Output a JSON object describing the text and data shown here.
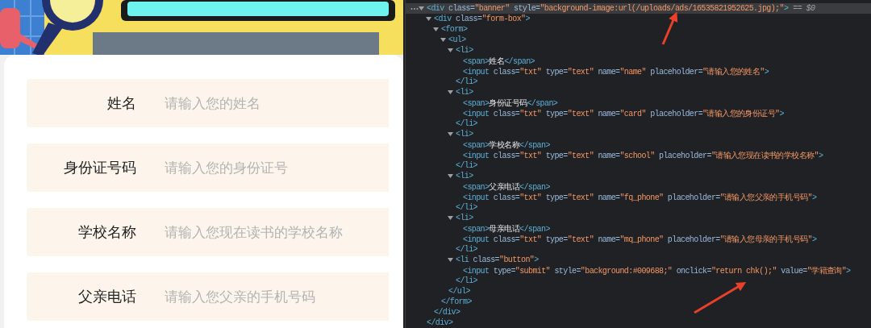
{
  "page": {
    "form": {
      "fields": [
        {
          "label": "姓名",
          "placeholder": "请输入您的姓名"
        },
        {
          "label": "身份证号码",
          "placeholder": "请输入您的身份证号"
        },
        {
          "label": "学校名称",
          "placeholder": "请输入您现在读书的学校名称"
        },
        {
          "label": "父亲电话",
          "placeholder": "请输入您父亲的手机号码"
        }
      ]
    }
  },
  "devtools": {
    "elements_tree": [
      {
        "expanded": true,
        "selected": true,
        "open": [
          {
            "kind": "tag",
            "text": "<div"
          },
          {
            "kind": "attr",
            "text": " class="
          },
          {
            "kind": "value",
            "text": "\"banner\""
          },
          {
            "kind": "attr",
            "text": " style="
          },
          {
            "kind": "value",
            "text": "\"background-image:url(/uploads/ads/16535821952625.jpg);\""
          },
          {
            "kind": "tag",
            "text": ">"
          }
        ],
        "marker": "== $0",
        "close": [
          {
            "kind": "tag",
            "text": "</div>"
          }
        ],
        "children": [
          {
            "expanded": true,
            "selected": false,
            "open": [
              {
                "kind": "tag",
                "text": "<div"
              },
              {
                "kind": "attr",
                "text": " class="
              },
              {
                "kind": "value",
                "text": "\"form-box\""
              },
              {
                "kind": "tag",
                "text": ">"
              }
            ],
            "close": [
              {
                "kind": "tag",
                "text": "</div>"
              }
            ],
            "children": [
              {
                "expanded": true,
                "selected": false,
                "open": [
                  {
                    "kind": "tag",
                    "text": "<form>"
                  }
                ],
                "close": [
                  {
                    "kind": "tag",
                    "text": "</form>"
                  }
                ],
                "children": [
                  {
                    "expanded": true,
                    "selected": false,
                    "open": [
                      {
                        "kind": "tag",
                        "text": "<ul>"
                      }
                    ],
                    "close": [
                      {
                        "kind": "tag",
                        "text": "</ul>"
                      }
                    ],
                    "children": [
                      {
                        "expanded": true,
                        "selected": false,
                        "open": [
                          {
                            "kind": "tag",
                            "text": "<li>"
                          }
                        ],
                        "close": [
                          {
                            "kind": "tag",
                            "text": "</li>"
                          }
                        ],
                        "children": [
                          {
                            "line": [
                              {
                                "kind": "tag",
                                "text": "<span>"
                              },
                              {
                                "kind": "text",
                                "text": "姓名"
                              },
                              {
                                "kind": "tag",
                                "text": "</span>"
                              }
                            ]
                          },
                          {
                            "line": [
                              {
                                "kind": "tag",
                                "text": "<input"
                              },
                              {
                                "kind": "attr",
                                "text": " class="
                              },
                              {
                                "kind": "value",
                                "text": "\"txt\""
                              },
                              {
                                "kind": "attr",
                                "text": " type="
                              },
                              {
                                "kind": "value",
                                "text": "\"text\""
                              },
                              {
                                "kind": "attr",
                                "text": " name="
                              },
                              {
                                "kind": "value",
                                "text": "\"name\""
                              },
                              {
                                "kind": "attr",
                                "text": " placeholder="
                              },
                              {
                                "kind": "value",
                                "text": "\"请输入您的姓名\""
                              },
                              {
                                "kind": "tag",
                                "text": ">"
                              }
                            ]
                          }
                        ]
                      },
                      {
                        "expanded": true,
                        "selected": false,
                        "open": [
                          {
                            "kind": "tag",
                            "text": "<li>"
                          }
                        ],
                        "close": [
                          {
                            "kind": "tag",
                            "text": "</li>"
                          }
                        ],
                        "children": [
                          {
                            "line": [
                              {
                                "kind": "tag",
                                "text": "<span>"
                              },
                              {
                                "kind": "text",
                                "text": "身份证号码"
                              },
                              {
                                "kind": "tag",
                                "text": "</span>"
                              }
                            ]
                          },
                          {
                            "line": [
                              {
                                "kind": "tag",
                                "text": "<input"
                              },
                              {
                                "kind": "attr",
                                "text": " class="
                              },
                              {
                                "kind": "value",
                                "text": "\"txt\""
                              },
                              {
                                "kind": "attr",
                                "text": " type="
                              },
                              {
                                "kind": "value",
                                "text": "\"text\""
                              },
                              {
                                "kind": "attr",
                                "text": " name="
                              },
                              {
                                "kind": "value",
                                "text": "\"card\""
                              },
                              {
                                "kind": "attr",
                                "text": " placeholder="
                              },
                              {
                                "kind": "value",
                                "text": "\"请输入您的身份证号\""
                              },
                              {
                                "kind": "tag",
                                "text": ">"
                              }
                            ]
                          }
                        ]
                      },
                      {
                        "expanded": true,
                        "selected": false,
                        "open": [
                          {
                            "kind": "tag",
                            "text": "<li>"
                          }
                        ],
                        "close": [
                          {
                            "kind": "tag",
                            "text": "</li>"
                          }
                        ],
                        "children": [
                          {
                            "line": [
                              {
                                "kind": "tag",
                                "text": "<span>"
                              },
                              {
                                "kind": "text",
                                "text": "学校名称"
                              },
                              {
                                "kind": "tag",
                                "text": "</span>"
                              }
                            ]
                          },
                          {
                            "line": [
                              {
                                "kind": "tag",
                                "text": "<input"
                              },
                              {
                                "kind": "attr",
                                "text": " class="
                              },
                              {
                                "kind": "value",
                                "text": "\"txt\""
                              },
                              {
                                "kind": "attr",
                                "text": " type="
                              },
                              {
                                "kind": "value",
                                "text": "\"text\""
                              },
                              {
                                "kind": "attr",
                                "text": " name="
                              },
                              {
                                "kind": "value",
                                "text": "\"school\""
                              },
                              {
                                "kind": "attr",
                                "text": " placeholder="
                              },
                              {
                                "kind": "value",
                                "text": "\"请输入您现在读书的学校名称\""
                              },
                              {
                                "kind": "tag",
                                "text": ">"
                              }
                            ]
                          }
                        ]
                      },
                      {
                        "expanded": true,
                        "selected": false,
                        "open": [
                          {
                            "kind": "tag",
                            "text": "<li>"
                          }
                        ],
                        "close": [
                          {
                            "kind": "tag",
                            "text": "</li>"
                          }
                        ],
                        "children": [
                          {
                            "line": [
                              {
                                "kind": "tag",
                                "text": "<span>"
                              },
                              {
                                "kind": "text",
                                "text": "父亲电话"
                              },
                              {
                                "kind": "tag",
                                "text": "</span>"
                              }
                            ]
                          },
                          {
                            "line": [
                              {
                                "kind": "tag",
                                "text": "<input"
                              },
                              {
                                "kind": "attr",
                                "text": " class="
                              },
                              {
                                "kind": "value",
                                "text": "\"txt\""
                              },
                              {
                                "kind": "attr",
                                "text": " type="
                              },
                              {
                                "kind": "value",
                                "text": "\"text\""
                              },
                              {
                                "kind": "attr",
                                "text": " name="
                              },
                              {
                                "kind": "value",
                                "text": "\"fq_phone\""
                              },
                              {
                                "kind": "attr",
                                "text": " placeholder="
                              },
                              {
                                "kind": "value",
                                "text": "\"请输入您父亲的手机号码\""
                              },
                              {
                                "kind": "tag",
                                "text": ">"
                              }
                            ]
                          }
                        ]
                      },
                      {
                        "expanded": true,
                        "selected": false,
                        "open": [
                          {
                            "kind": "tag",
                            "text": "<li>"
                          }
                        ],
                        "close": [
                          {
                            "kind": "tag",
                            "text": "</li>"
                          }
                        ],
                        "children": [
                          {
                            "line": [
                              {
                                "kind": "tag",
                                "text": "<span>"
                              },
                              {
                                "kind": "text",
                                "text": "母亲电话"
                              },
                              {
                                "kind": "tag",
                                "text": "</span>"
                              }
                            ]
                          },
                          {
                            "line": [
                              {
                                "kind": "tag",
                                "text": "<input"
                              },
                              {
                                "kind": "attr",
                                "text": " class="
                              },
                              {
                                "kind": "value",
                                "text": "\"txt\""
                              },
                              {
                                "kind": "attr",
                                "text": " type="
                              },
                              {
                                "kind": "value",
                                "text": "\"text\""
                              },
                              {
                                "kind": "attr",
                                "text": " name="
                              },
                              {
                                "kind": "value",
                                "text": "\"mq_phone\""
                              },
                              {
                                "kind": "attr",
                                "text": " placeholder="
                              },
                              {
                                "kind": "value",
                                "text": "\"请输入您母亲的手机号码\""
                              },
                              {
                                "kind": "tag",
                                "text": ">"
                              }
                            ]
                          }
                        ]
                      },
                      {
                        "expanded": true,
                        "selected": false,
                        "open": [
                          {
                            "kind": "tag",
                            "text": "<li"
                          },
                          {
                            "kind": "attr",
                            "text": " class="
                          },
                          {
                            "kind": "value",
                            "text": "\"button\""
                          },
                          {
                            "kind": "tag",
                            "text": ">"
                          }
                        ],
                        "close": [
                          {
                            "kind": "tag",
                            "text": "</li>"
                          }
                        ],
                        "children": [
                          {
                            "line": [
                              {
                                "kind": "tag",
                                "text": "<input"
                              },
                              {
                                "kind": "attr",
                                "text": " type="
                              },
                              {
                                "kind": "value",
                                "text": "\"submit\""
                              },
                              {
                                "kind": "attr",
                                "text": " style="
                              },
                              {
                                "kind": "value",
                                "text": "\"background:#009688;\""
                              },
                              {
                                "kind": "attr",
                                "text": " onclick="
                              },
                              {
                                "kind": "value",
                                "text": "\"return chk();\""
                              },
                              {
                                "kind": "attr",
                                "text": " value="
                              },
                              {
                                "kind": "value",
                                "text": "\"学籍查询\""
                              },
                              {
                                "kind": "tag",
                                "text": ">"
                              }
                            ]
                          }
                        ]
                      }
                    ]
                  }
                ]
              }
            ]
          }
        ]
      }
    ]
  },
  "annotations": [
    {
      "kind": "arrow"
    },
    {
      "kind": "arrow"
    }
  ]
}
